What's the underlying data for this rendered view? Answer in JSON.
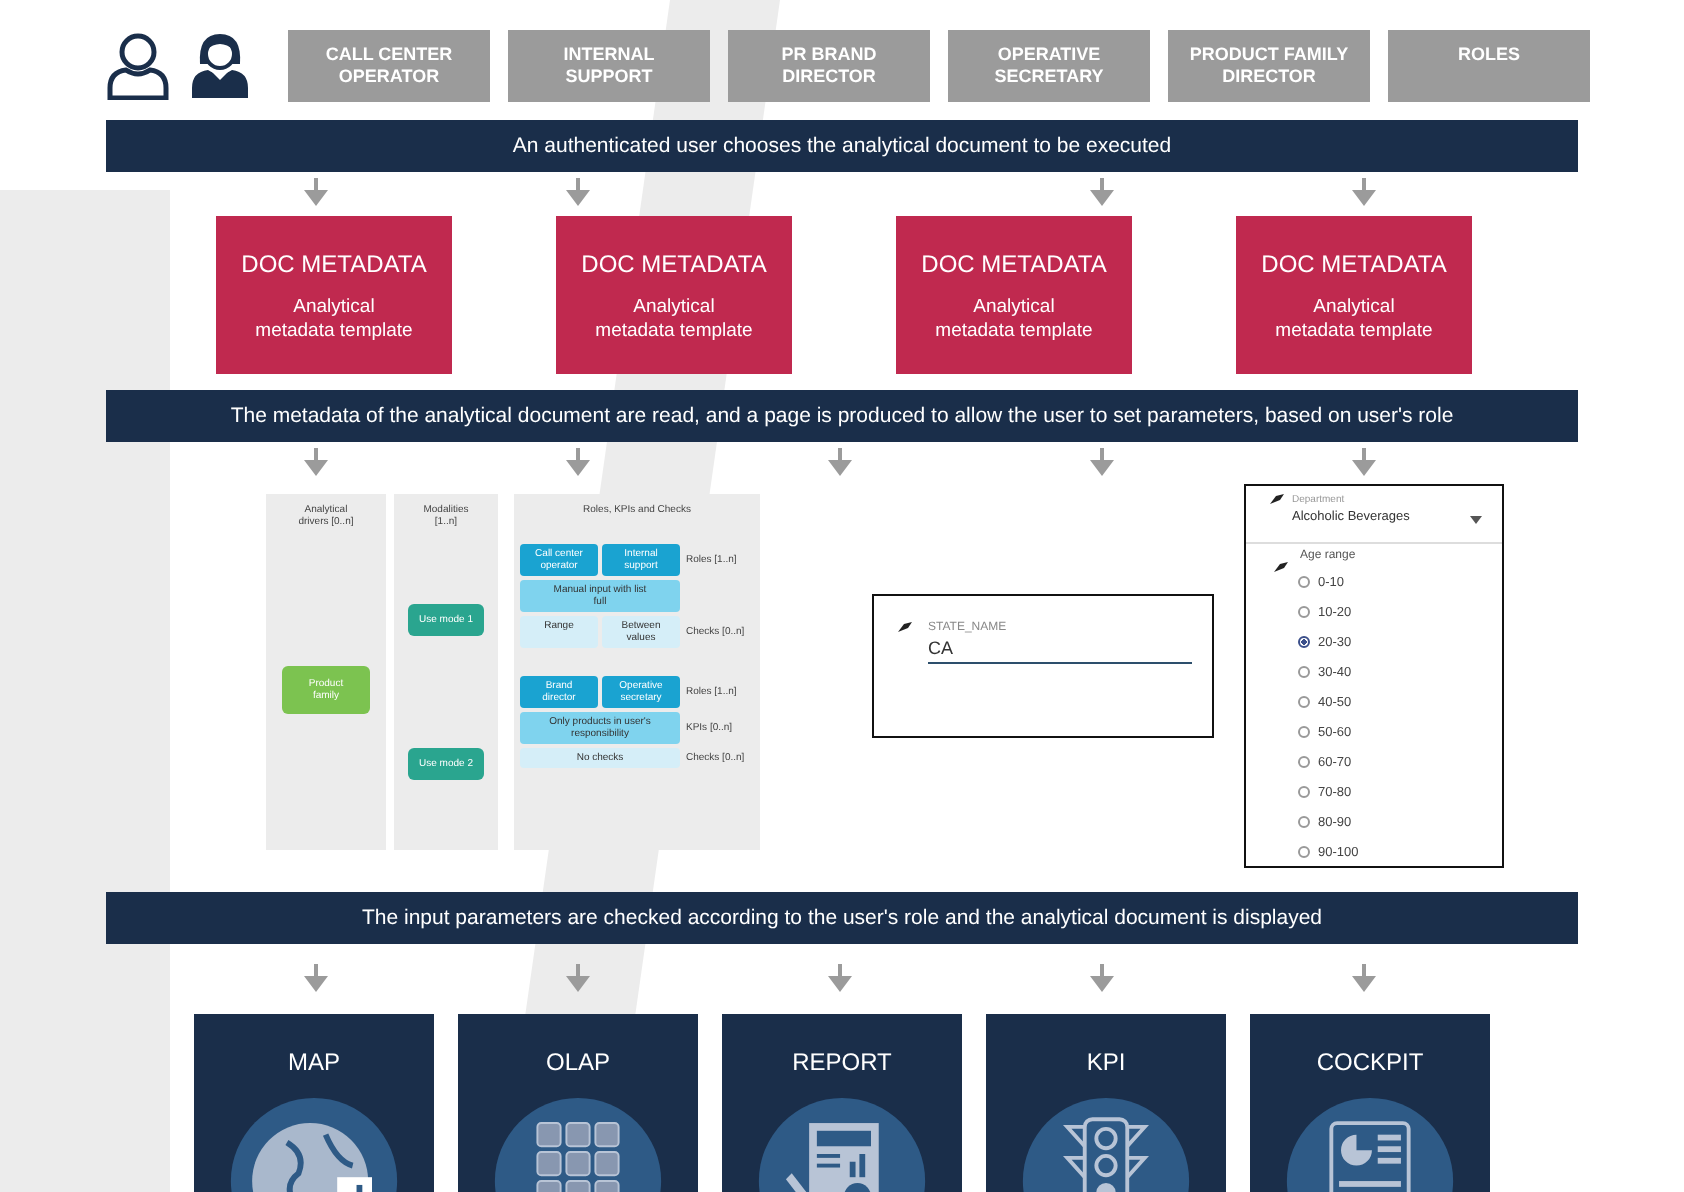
{
  "roles": [
    "CALL CENTER\nOPERATOR",
    "INTERNAL\nSUPPORT",
    "PR BRAND\nDIRECTOR",
    "OPERATIVE\nSECRETARY",
    "PRODUCT FAMILY\nDIRECTOR",
    "ROLES"
  ],
  "banners": [
    "An authenticated user chooses the analytical document to be executed",
    "The metadata of the analytical document are read, and a page is produced to allow the user to set parameters, based on user's role",
    "The input parameters are checked according to the user's role and the analytical document is displayed"
  ],
  "doc_cards": [
    {
      "title": "DOC METADATA",
      "subtitle": "Analytical\nmetadata template"
    },
    {
      "title": "DOC METADATA",
      "subtitle": "Analytical\nmetadata template"
    },
    {
      "title": "DOC METADATA",
      "subtitle": "Analytical\nmetadata template"
    },
    {
      "title": "DOC METADATA",
      "subtitle": "Analytical\nmetadata template"
    }
  ],
  "diagram": {
    "columns": [
      "Analytical\ndrivers [0..n]",
      "Modalities\n[1..n]",
      "Roles, KPIs and Checks"
    ],
    "driver": "Product\nfamily",
    "modes": [
      {
        "label": "Use mode 1",
        "roles": [
          "Call center\noperator",
          "Internal\nsupport"
        ],
        "kpi": "Manual input with list\nfull",
        "checks": [
          "Range",
          "Between\nvalues"
        ],
        "row_labels": [
          "Roles [1..n]",
          "Checks [0..n]"
        ]
      },
      {
        "label": "Use mode 2",
        "roles": [
          "Brand\ndirector",
          "Operative\nsecretary"
        ],
        "kpi": "Only products in user's\nresponsibility",
        "checks": [
          "No checks"
        ],
        "row_labels": [
          "Roles [1..n]",
          "KPIs [0..n]",
          "Checks [0..n]"
        ]
      }
    ]
  },
  "text_field": {
    "label": "STATE_NAME",
    "value": "CA"
  },
  "form_panel": {
    "dropdown": {
      "label": "Department",
      "value": "Alcoholic Beverages"
    },
    "radio_label": "Age range",
    "options": [
      {
        "label": "0-10",
        "selected": false
      },
      {
        "label": "10-20",
        "selected": false
      },
      {
        "label": "20-30",
        "selected": true
      },
      {
        "label": "30-40",
        "selected": false
      },
      {
        "label": "40-50",
        "selected": false
      },
      {
        "label": "50-60",
        "selected": false
      },
      {
        "label": "60-70",
        "selected": false
      },
      {
        "label": "70-80",
        "selected": false
      },
      {
        "label": "80-90",
        "selected": false
      },
      {
        "label": "90-100",
        "selected": false
      }
    ]
  },
  "outputs": [
    {
      "label": "MAP",
      "kind": "globe"
    },
    {
      "label": "OLAP",
      "kind": "grid"
    },
    {
      "label": "REPORT",
      "kind": "report"
    },
    {
      "label": "KPI",
      "kind": "traffic"
    },
    {
      "label": "COCKPIT",
      "kind": "dashboard"
    }
  ]
}
